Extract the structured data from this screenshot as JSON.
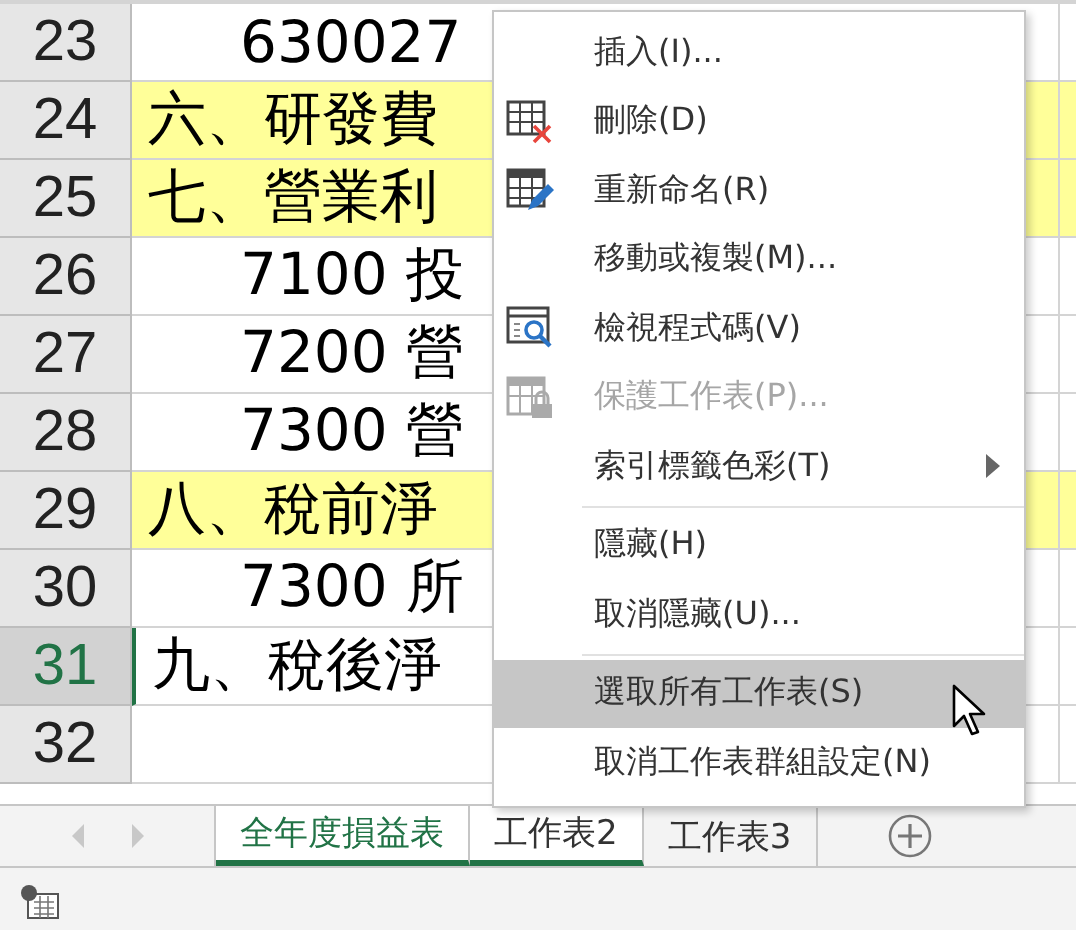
{
  "rows": [
    {
      "number": "23",
      "text": "630027",
      "indent": true,
      "highlight": false,
      "selected": false
    },
    {
      "number": "24",
      "text": "六、研發費",
      "indent": false,
      "highlight": true,
      "selected": false
    },
    {
      "number": "25",
      "text": "七、營業利",
      "indent": false,
      "highlight": true,
      "selected": false
    },
    {
      "number": "26",
      "text": "7100 投",
      "indent": true,
      "highlight": false,
      "selected": false
    },
    {
      "number": "27",
      "text": "7200 營",
      "indent": true,
      "highlight": false,
      "selected": false
    },
    {
      "number": "28",
      "text": "7300 營",
      "indent": true,
      "highlight": false,
      "selected": false
    },
    {
      "number": "29",
      "text": "八、稅前淨",
      "indent": false,
      "highlight": true,
      "selected": false
    },
    {
      "number": "30",
      "text": "7300 所",
      "indent": true,
      "highlight": false,
      "selected": false
    },
    {
      "number": "31",
      "text": "九、稅後淨",
      "indent": false,
      "highlight": false,
      "selected": true
    },
    {
      "number": "32",
      "text": "",
      "indent": false,
      "highlight": false,
      "selected": false
    }
  ],
  "context_menu": [
    {
      "kind": "command",
      "label": "插入(I)...",
      "disabled": false,
      "selected": false
    },
    {
      "kind": "command",
      "label": "刪除(D)",
      "disabled": false,
      "selected": false
    },
    {
      "kind": "command",
      "label": "重新命名(R)",
      "disabled": false,
      "selected": false
    },
    {
      "kind": "command",
      "label": "移動或複製(M)...",
      "disabled": false,
      "selected": false
    },
    {
      "kind": "command",
      "label": "檢視程式碼(V)",
      "disabled": false,
      "selected": false
    },
    {
      "kind": "command",
      "label": "保護工作表(P)...",
      "disabled": true,
      "selected": false
    },
    {
      "kind": "submenu",
      "label": "索引標籤色彩(T)",
      "disabled": false,
      "selected": false
    },
    {
      "kind": "separator"
    },
    {
      "kind": "command",
      "label": "隱藏(H)",
      "disabled": false,
      "selected": false
    },
    {
      "kind": "command",
      "label": "取消隱藏(U)...",
      "disabled": false,
      "selected": false
    },
    {
      "kind": "separator"
    },
    {
      "kind": "command",
      "label": "選取所有工作表(S)",
      "disabled": false,
      "selected": true
    },
    {
      "kind": "command",
      "label": "取消工作表群組設定(N)",
      "disabled": false,
      "selected": false
    }
  ],
  "sheet_tabs": [
    {
      "label": "全年度損益表",
      "selected": true,
      "active": true
    },
    {
      "label": "工作表2",
      "selected": true,
      "active": false
    },
    {
      "label": "工作表3",
      "selected": false,
      "active": false
    }
  ]
}
